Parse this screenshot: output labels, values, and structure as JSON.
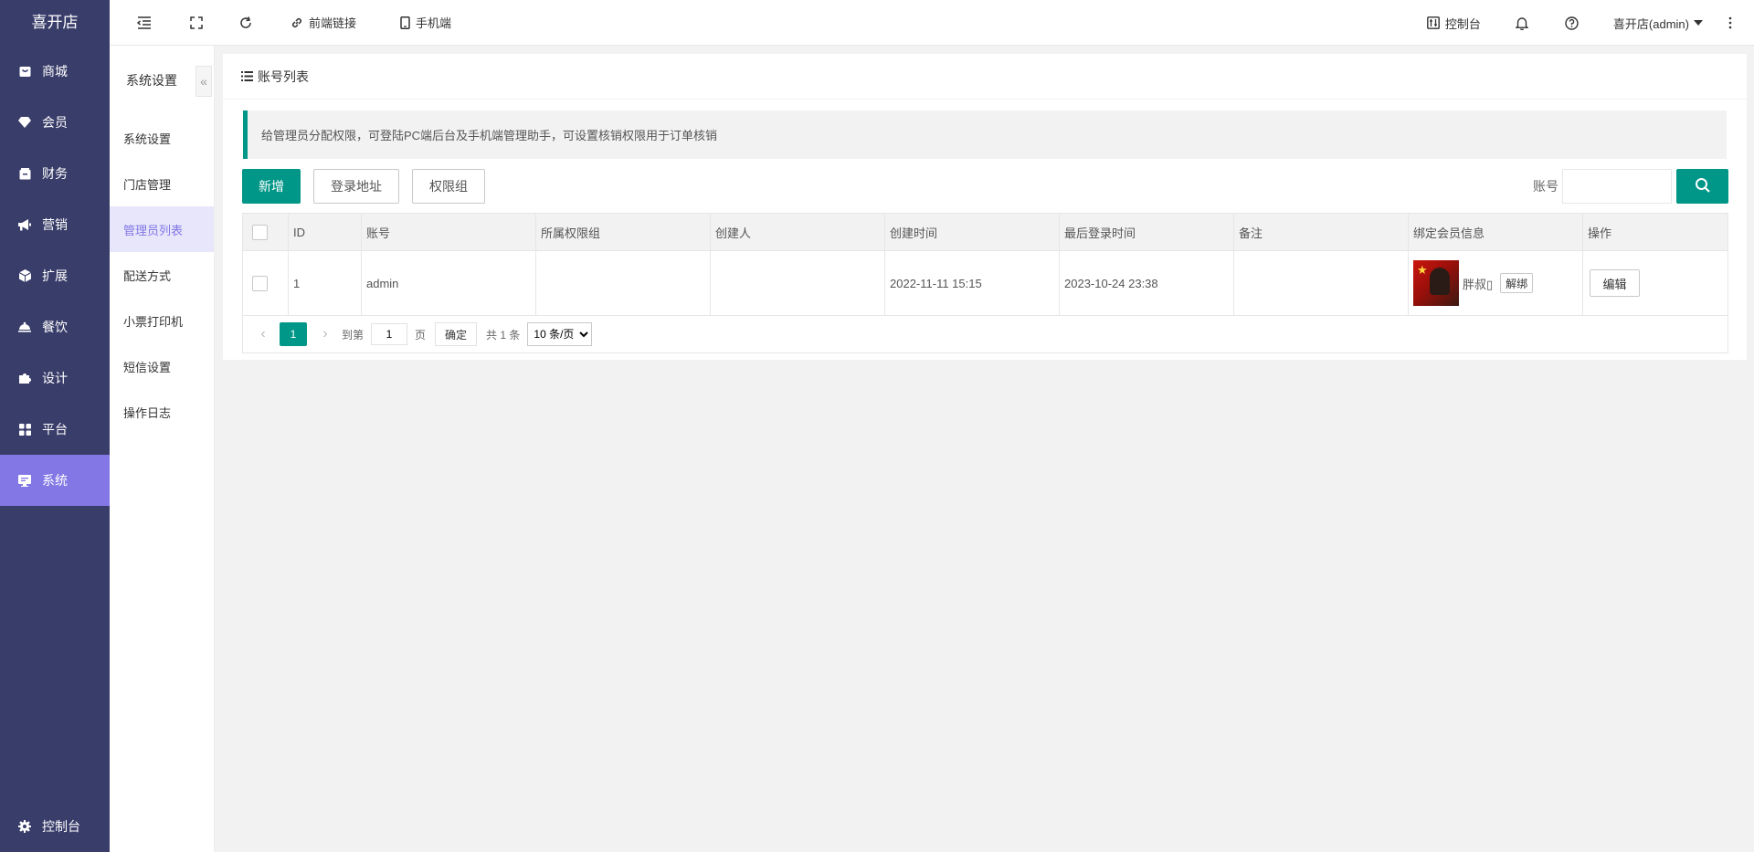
{
  "brand": "喜开店",
  "sidebar": {
    "items": [
      {
        "label": "商城",
        "icon": "shop-icon"
      },
      {
        "label": "会员",
        "icon": "diamond-icon"
      },
      {
        "label": "财务",
        "icon": "wallet-icon"
      },
      {
        "label": "营销",
        "icon": "megaphone-icon"
      },
      {
        "label": "扩展",
        "icon": "cube-icon"
      },
      {
        "label": "餐饮",
        "icon": "cloche-icon"
      },
      {
        "label": "设计",
        "icon": "puzzle-icon"
      },
      {
        "label": "平台",
        "icon": "grid-icon"
      },
      {
        "label": "系统",
        "icon": "monitor-icon"
      }
    ],
    "active_index": 8,
    "bottom_label": "控制台"
  },
  "subnav": {
    "title": "系统设置",
    "collapse_symbol": "«",
    "items": [
      "系统设置",
      "门店管理",
      "管理员列表",
      "配送方式",
      "小票打印机",
      "短信设置",
      "操作日志"
    ],
    "active_index": 2
  },
  "topbar": {
    "frontend_link": "前端链接",
    "mobile": "手机端",
    "console": "控制台",
    "user": "喜开店(admin)"
  },
  "panel": {
    "title": "账号列表",
    "tip": "给管理员分配权限，可登陆PC端后台及手机端管理助手，可设置核销权限用于订单核销"
  },
  "toolbar": {
    "add": "新增",
    "login_url": "登录地址",
    "role_group": "权限组",
    "search_label": "账号",
    "search_value": ""
  },
  "table": {
    "headers": [
      "",
      "ID",
      "账号",
      "所属权限组",
      "创建人",
      "创建时间",
      "最后登录时间",
      "备注",
      "绑定会员信息",
      "操作"
    ],
    "rows": [
      {
        "id": "1",
        "account": "admin",
        "role_group": "",
        "creator": "",
        "created_at": "2022-11-11 15:15",
        "last_login": "2023-10-24 23:38",
        "remark": "",
        "member_name": "胖叔▯",
        "unbind": "解绑",
        "edit": "编辑"
      }
    ]
  },
  "pager": {
    "current": "1",
    "goto_label": "到第",
    "goto_value": "1",
    "page_unit": "页",
    "confirm": "确定",
    "total": "共 1 条",
    "limit": "10 条/页"
  },
  "colors": {
    "sidebar_bg": "#393d6a",
    "accent_purple": "#8377e6",
    "primary_green": "#009688"
  }
}
